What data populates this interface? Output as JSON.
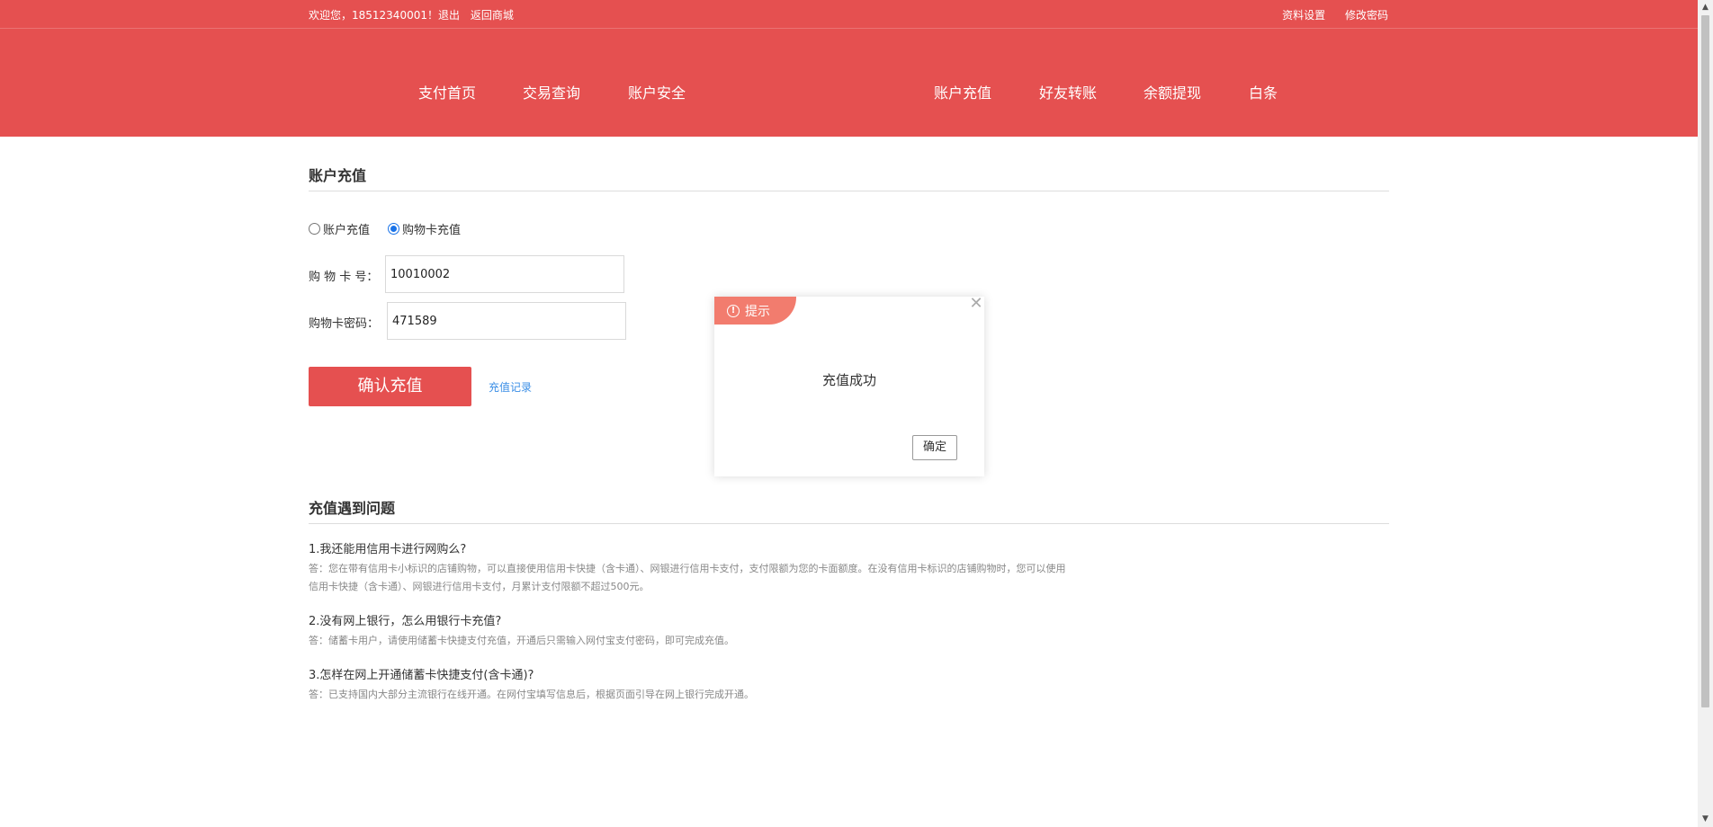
{
  "topbar": {
    "welcome": "欢迎您，18512340001！退出",
    "back_to_shop": "返回商城",
    "profile_settings": "资料设置",
    "change_password": "修改密码"
  },
  "nav": {
    "items": [
      "支付首页",
      "交易查询",
      "账户安全",
      "账户充值",
      "好友转账",
      "余额提现",
      "白条"
    ]
  },
  "recharge": {
    "title": "账户充值",
    "options": [
      "账户充值",
      "购物卡充值"
    ],
    "selected": "购物卡充值",
    "card_no_label": "购 物 卡 号：",
    "card_no_value": "10010002",
    "card_pwd_label": "购物卡密码：",
    "card_pwd_value": "471589",
    "confirm_label": "确认充值",
    "record_link": "充值记录"
  },
  "faq": {
    "title": "充值遇到问题",
    "items": [
      {
        "q": "1.我还能用信用卡进行网购么?",
        "a": "答：您在带有信用卡小标识的店铺购物，可以直接使用信用卡快捷（含卡通）、网银进行信用卡支付，支付限额为您的卡面额度。在没有信用卡标识的店铺购物时，您可以使用信用卡快捷（含卡通）、网银进行信用卡支付，月累计支付限额不超过500元。"
      },
      {
        "q": "2.没有网上银行，怎么用银行卡充值?",
        "a": "答：储蓄卡用户，请使用储蓄卡快捷支付充值，开通后只需输入网付宝支付密码，即可完成充值。"
      },
      {
        "q": "3.怎样在网上开通储蓄卡快捷支付(含卡通)?",
        "a": "答：已支持国内大部分主流银行在线开通。在网付宝填写信息后，根据页面引导在网上银行完成开通。"
      }
    ]
  },
  "dialog": {
    "title": "提示",
    "message": "充值成功",
    "ok_label": "确定"
  },
  "colors": {
    "brand": "#e55050",
    "dialog_tag": "#f27c6e",
    "link": "#3a8ee6"
  }
}
